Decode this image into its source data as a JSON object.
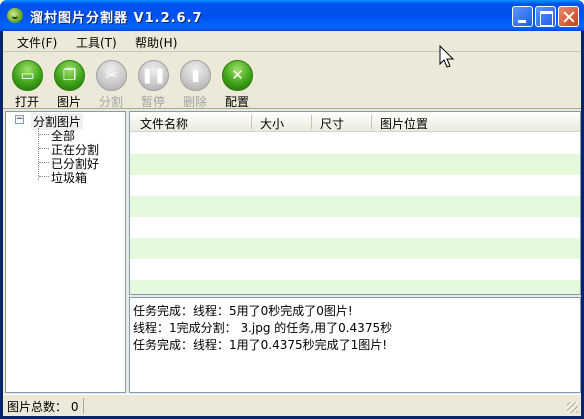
{
  "window": {
    "title": "溜村图片分割器 V1.2.6.7"
  },
  "menu": {
    "file": "文件(F)",
    "tools": "工具(T)",
    "help": "帮助(H)"
  },
  "toolbar": {
    "open": "打开",
    "image": "图片",
    "split": "分割",
    "pause": "暂停",
    "delete": "删除",
    "config": "配置"
  },
  "tree": {
    "root": "分割图片",
    "toggle_symbol": "−",
    "children": [
      "全部",
      "正在分割",
      "已分割好",
      "垃圾箱"
    ]
  },
  "list": {
    "columns": [
      "文件名称",
      "大小",
      "尺寸",
      "图片位置"
    ],
    "rows": []
  },
  "log": {
    "lines": [
      "任务完成：线程：5用了0秒完成了0图片!",
      "线程：1完成分割： 3.jpg 的任务,用了0.4375秒",
      "任务完成：线程：1用了0.4375秒完成了1图片!"
    ]
  },
  "status": {
    "total_label": "图片总数：",
    "total_value": "0",
    "text": "图片总数： 0"
  },
  "colors": {
    "titlebar": "#0054e3",
    "chrome": "#ece9d8",
    "alt_row": "#e5f9dc",
    "tool_green": "#3fa31a"
  }
}
